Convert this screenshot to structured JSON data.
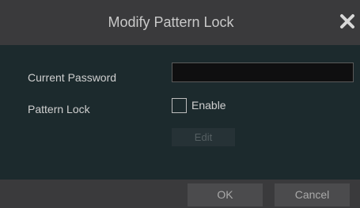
{
  "dialog": {
    "title": "Modify Pattern Lock",
    "close_icon": "close-icon"
  },
  "form": {
    "current_password_label": "Current Password",
    "current_password_value": "",
    "pattern_lock_label": "Pattern Lock",
    "enable_label": "Enable",
    "enable_checked": false,
    "edit_label": "Edit"
  },
  "footer": {
    "ok_label": "OK",
    "cancel_label": "Cancel"
  }
}
